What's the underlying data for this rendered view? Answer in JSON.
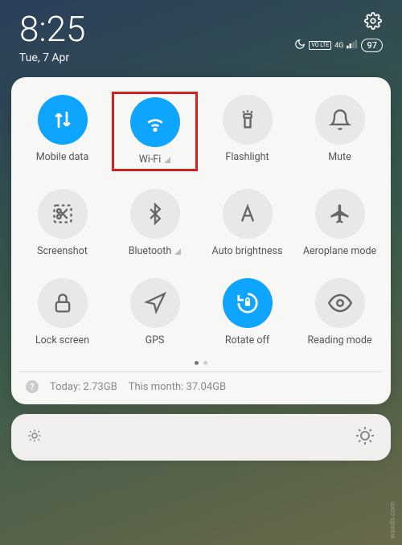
{
  "statusBar": {
    "time": "8:25",
    "date": "Tue, 7 Apr",
    "battery": "97",
    "networkBadge": "VO LTE",
    "signalBadge": "4G"
  },
  "tiles": [
    {
      "id": "mobile-data",
      "label": "Mobile data",
      "icon": "data-arrows",
      "active": true,
      "highlight": false,
      "indicator": false
    },
    {
      "id": "wifi",
      "label": "Wi-Fi",
      "icon": "wifi",
      "active": true,
      "highlight": true,
      "indicator": true
    },
    {
      "id": "flashlight",
      "label": "Flashlight",
      "icon": "flashlight",
      "active": false,
      "highlight": false,
      "indicator": false
    },
    {
      "id": "mute",
      "label": "Mute",
      "icon": "bell",
      "active": false,
      "highlight": false,
      "indicator": false
    },
    {
      "id": "screenshot",
      "label": "Screenshot",
      "icon": "scissors",
      "active": false,
      "highlight": false,
      "indicator": false
    },
    {
      "id": "bluetooth",
      "label": "Bluetooth",
      "icon": "bluetooth",
      "active": false,
      "highlight": false,
      "indicator": true
    },
    {
      "id": "auto-brightness",
      "label": "Auto brightness",
      "icon": "letter-a",
      "active": false,
      "highlight": false,
      "indicator": false
    },
    {
      "id": "aeroplane",
      "label": "Aeroplane mode",
      "icon": "airplane",
      "active": false,
      "highlight": false,
      "indicator": false
    },
    {
      "id": "lock-screen",
      "label": "Lock screen",
      "icon": "lock",
      "active": false,
      "highlight": false,
      "indicator": false
    },
    {
      "id": "gps",
      "label": "GPS",
      "icon": "nav-arrow",
      "active": false,
      "highlight": false,
      "indicator": false
    },
    {
      "id": "rotate",
      "label": "Rotate off",
      "icon": "rotate-lock",
      "active": true,
      "highlight": false,
      "indicator": false
    },
    {
      "id": "reading",
      "label": "Reading mode",
      "icon": "eye",
      "active": false,
      "highlight": false,
      "indicator": false
    }
  ],
  "dataUsage": {
    "todayLabel": "Today:",
    "todayValue": "2.73GB",
    "monthLabel": "This month:",
    "monthValue": "37.04GB"
  },
  "watermark": "wsxdn.com"
}
